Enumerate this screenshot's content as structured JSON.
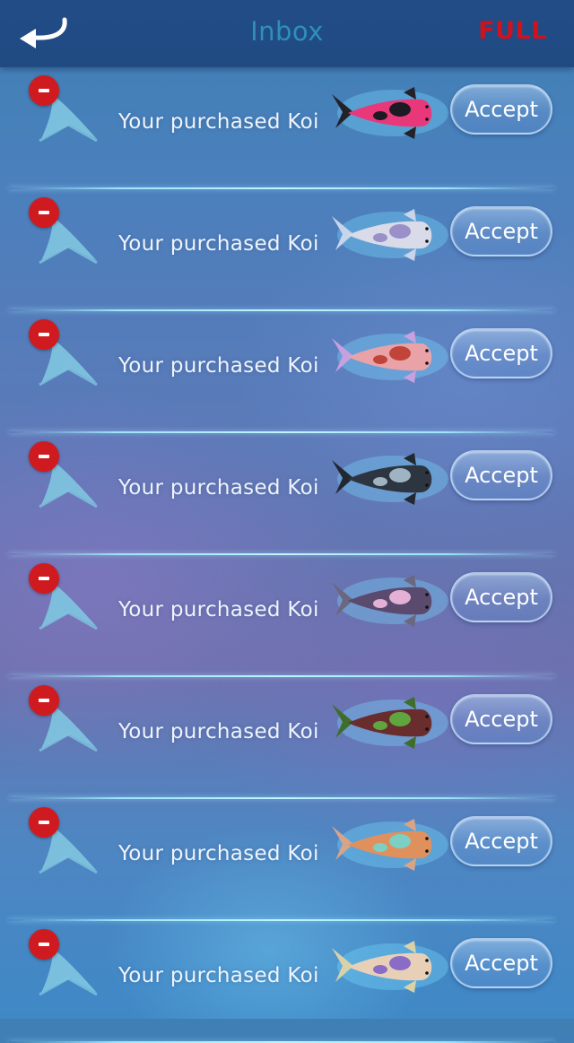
{
  "header": {
    "back_icon": "back-arrow-icon",
    "title": "Inbox",
    "status": "FULL",
    "status_color": "#d0121c",
    "title_color": "#2f8fba"
  },
  "inbox": {
    "items": [
      {
        "message": "Your purchased Koi",
        "accept_label": "Accept",
        "koi_colors": [
          "#e8387a",
          "#1c1a22"
        ],
        "fin_color": "#222228"
      },
      {
        "message": "Your purchased Koi",
        "accept_label": "Accept",
        "koi_colors": [
          "#d9dbe8",
          "#9a8fc9"
        ],
        "fin_color": "#c8d4ea"
      },
      {
        "message": "Your purchased Koi",
        "accept_label": "Accept",
        "koi_colors": [
          "#e8a2a8",
          "#c0443a"
        ],
        "fin_color": "#c7a0e0"
      },
      {
        "message": "Your purchased Koi",
        "accept_label": "Accept",
        "koi_colors": [
          "#2d3540",
          "#9fb4c2"
        ],
        "fin_color": "#22282f"
      },
      {
        "message": "Your purchased Koi",
        "accept_label": "Accept",
        "koi_colors": [
          "#5a4a6e",
          "#e5b0d6"
        ],
        "fin_color": "#6a6780"
      },
      {
        "message": "Your purchased Koi",
        "accept_label": "Accept",
        "koi_colors": [
          "#6a2d2d",
          "#5fa640"
        ],
        "fin_color": "#3f6e2c"
      },
      {
        "message": "Your purchased Koi",
        "accept_label": "Accept",
        "koi_colors": [
          "#e0905c",
          "#7ccfc5"
        ],
        "fin_color": "#d8a488"
      },
      {
        "message": "Your purchased Koi",
        "accept_label": "Accept",
        "koi_colors": [
          "#e8d0b8",
          "#8a6cc6"
        ],
        "fin_color": "#d9d2a6"
      }
    ]
  }
}
